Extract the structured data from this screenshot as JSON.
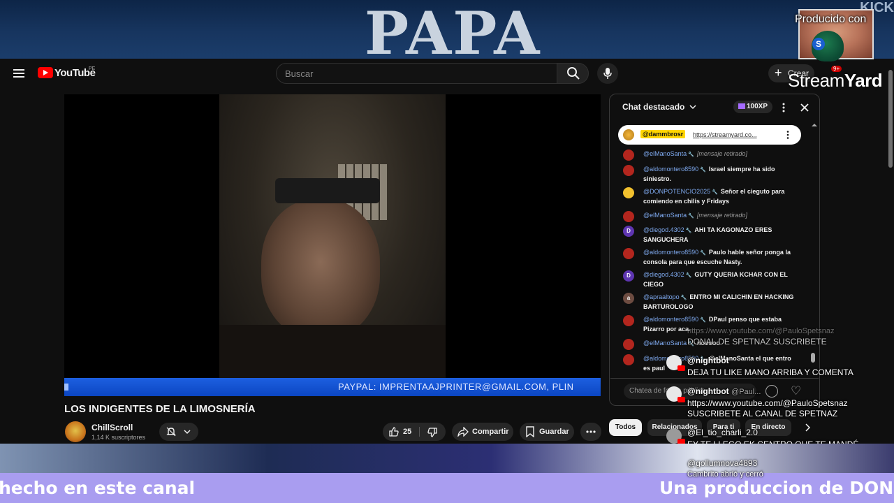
{
  "banner": {
    "headline": "PAPA",
    "corner_text": "KICK"
  },
  "streamyard": {
    "produced_by": "Producido con",
    "brand_prefix": "Stream",
    "brand_suffix": "Yard",
    "badge_letter": "S"
  },
  "header": {
    "logo_text": "YouTube",
    "country_code": "PE",
    "search_placeholder": "Buscar",
    "create_label": "Crear",
    "notifications_count": "9+"
  },
  "video": {
    "ticker_text": "PAYPAL: IMPRENTAAJPRINTER@GMAIL.COM, PLIN",
    "title": "LOS INDIGENTES DE LA LIMOSNERÍA",
    "channel_name": "ChillScroll",
    "subscribers": "1,14 K suscriptores",
    "likes": "25",
    "share_label": "Compartir",
    "save_label": "Guardar"
  },
  "chat": {
    "title": "Chat destacado",
    "xp_badge": "100XP",
    "pinned": {
      "user": "@dammbrosr",
      "link": "https://streamyard.co..."
    },
    "messages": [
      {
        "user": "@elManoSanta",
        "text": "[mensaje retirado]",
        "removed": true,
        "avatar": "",
        "avatar_color": "#b3261e"
      },
      {
        "user": "@aldomontero8590",
        "text": "Israel siempre ha sido siniestro.",
        "removed": false,
        "avatar": "",
        "avatar_color": "#b3261e"
      },
      {
        "user": "@DONPOTENCIO2025",
        "text": "Señor el cieguto para comiendo en chilis y Fridays",
        "removed": false,
        "avatar": "",
        "avatar_color": "#f2c12e"
      },
      {
        "user": "@elManoSanta",
        "text": "[mensaje retirado]",
        "removed": true,
        "avatar": "",
        "avatar_color": "#b3261e"
      },
      {
        "user": "@diegod.4302",
        "text": "AHI TA KAGONAZO ERES SANGUCHERA",
        "removed": false,
        "avatar": "D",
        "avatar_color": "#5e35b1"
      },
      {
        "user": "@aldomontero8590",
        "text": "Paulo hable señor ponga la consola para que escuche Nasty.",
        "removed": false,
        "avatar": "",
        "avatar_color": "#b3261e"
      },
      {
        "user": "@diegod.4302",
        "text": "GUTY QUERIA KCHAR CON EL CIEGO",
        "removed": false,
        "avatar": "D",
        "avatar_color": "#5e35b1"
      },
      {
        "user": "@apraaltopo",
        "text": "ENTRO MI CALICHIN EN HACKING BARTUROLOGO",
        "removed": false,
        "avatar": "a",
        "avatar_color": "#6d4c41"
      },
      {
        "user": "@aldomontero8590",
        "text": "DPaul penso que estaba Pizarro por aca.",
        "removed": false,
        "avatar": "",
        "avatar_color": "#b3261e"
      },
      {
        "user": "@elManoSanta",
        "text": "nooooo",
        "removed": false,
        "avatar": "",
        "avatar_color": "#b3261e"
      },
      {
        "user": "@aldomontero8590",
        "text": "@elManoSanta el que entro es paul",
        "removed": false,
        "avatar": "",
        "avatar_color": "#b3261e"
      }
    ],
    "input_placeholder": "Chatea de forma pública...",
    "chips": [
      "Todos",
      "Relacionados",
      "Para ti",
      "En directo"
    ]
  },
  "overlay_comments": {
    "faded_url": "https://www.youtube.com/@PauloSpetsnaz",
    "faded_line": "DONAL DE SPETNAZ SUSCRIBETE",
    "c1": {
      "user": "@nightbot",
      "text": "DEJA TU LIKE MANO ARRIBA Y COMENTA"
    },
    "c2": {
      "user": "@nightbot",
      "user_suffix": "@Paul...",
      "text1": "https://www.youtube.com/@PauloSpetsnaz",
      "text2": "SUSCRIBETE AL CANAL DE SPETNAZ"
    },
    "c3": {
      "user": "@El_tio_charli_2.0",
      "text": "EY TE LLEGO EK CENTRO QUE TE MANDÉ"
    },
    "c4": {
      "user": "@gollumnova4893",
      "text": "Cambrito abrió y cerró"
    }
  },
  "bottom_banner": {
    "left_text": "hecho en este canal",
    "right_text": "Una produccion de DON M"
  },
  "colors": {
    "ticker_blue": "#1d5fe0",
    "bottom_bar": "#a99df0",
    "yt_red": "#ff0000",
    "pinned_highlight": "#ffd600"
  }
}
